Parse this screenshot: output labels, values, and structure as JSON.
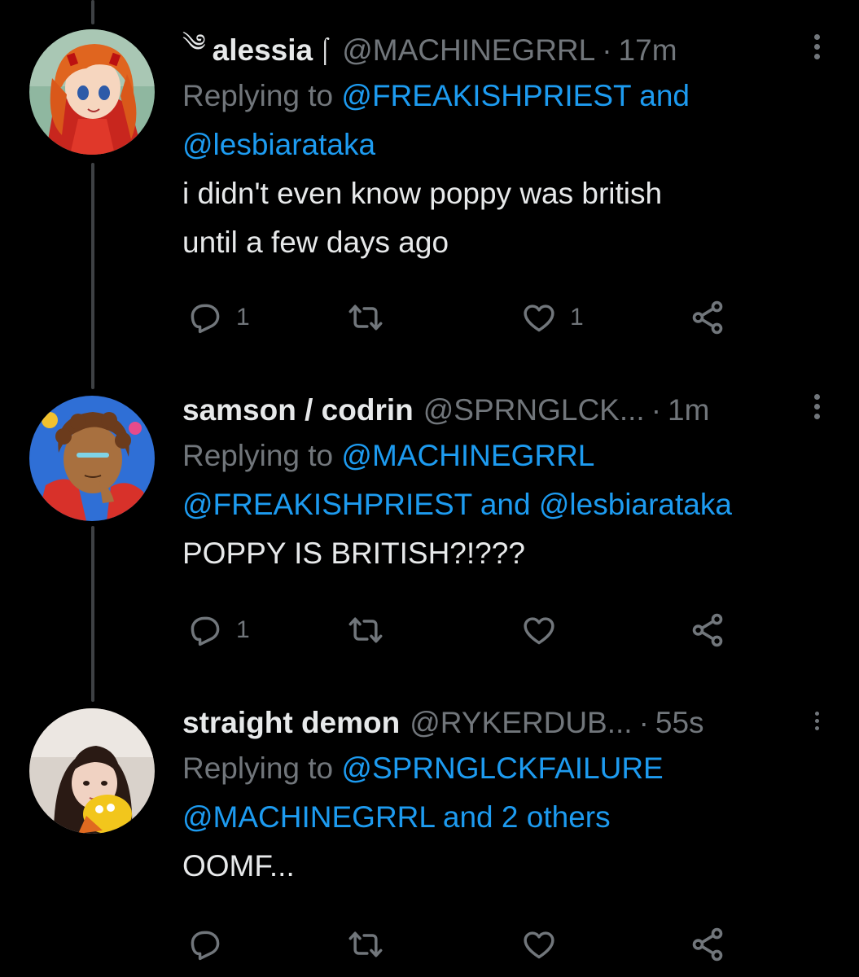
{
  "colors": {
    "background": "#000000",
    "text": "#e7e9ea",
    "muted": "#71767b",
    "link": "#1d9bf0",
    "thread_line": "#3e4144"
  },
  "tweets": [
    {
      "name_deco_left": "༄",
      "name": "alessia",
      "name_deco_right": "⌠",
      "handle": "@MACHINEGRRL",
      "dot": "·",
      "time": "17m",
      "replying_prefix": "Replying to ",
      "replying_line1_mentions": "@FREAKISHPRIEST",
      "replying_line1_and": " and",
      "replying_line2": "@lesbiarataka",
      "body_lines": [
        "i didn't even know poppy was british",
        "until a few days ago"
      ],
      "reply_count": "1",
      "retweet_count": "",
      "like_count": "1",
      "avatar_icon": "avatar-image"
    },
    {
      "name": "samson / codrin",
      "handle": "@SPRNGLCK...",
      "dot": "·",
      "time": "1m",
      "replying_prefix": "Replying to ",
      "replying_line1_mentions": "@MACHINEGRRL",
      "replying_line2_a": "@FREAKISHPRIEST",
      "replying_line2_and": " and ",
      "replying_line2_b": "@lesbiarataka",
      "body_lines": [
        "POPPY IS BRITISH?!???"
      ],
      "reply_count": "1",
      "retweet_count": "",
      "like_count": ""
    },
    {
      "name": "straight demon",
      "handle": "@RYKERDUB...",
      "dot": "·",
      "time": "55s",
      "replying_prefix": "Replying to ",
      "replying_line1_mentions": "@SPRNGLCKFAILURE",
      "replying_line2_a": "@MACHINEGRRL",
      "replying_line2_and": " and ",
      "replying_line2_b": "2 others",
      "body_lines": [
        "OOMF..."
      ],
      "reply_count": "",
      "retweet_count": "",
      "like_count": ""
    }
  ]
}
